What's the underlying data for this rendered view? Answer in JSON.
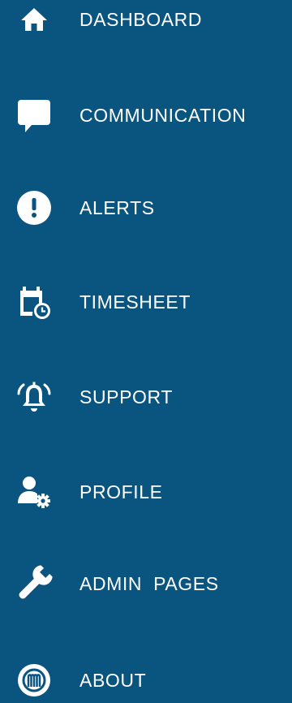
{
  "theme": {
    "background": "#0a5480",
    "text": "#ffffff"
  },
  "nav": {
    "items": [
      {
        "label": "DASHBOARD",
        "icon": "home-icon"
      },
      {
        "label": "COMMUNICATION",
        "icon": "chat-bubble-icon"
      },
      {
        "label": "ALERTS",
        "icon": "alert-circle-icon"
      },
      {
        "label": "TIMESHEET",
        "icon": "calendar-clock-icon"
      },
      {
        "label": "SUPPORT",
        "icon": "bell-ringing-icon"
      },
      {
        "label": "PROFILE",
        "icon": "user-settings-icon"
      },
      {
        "label": "ADMIN  PAGES",
        "icon": "wrench-icon"
      },
      {
        "label": "ABOUT",
        "icon": "brand-logo-icon"
      }
    ]
  }
}
